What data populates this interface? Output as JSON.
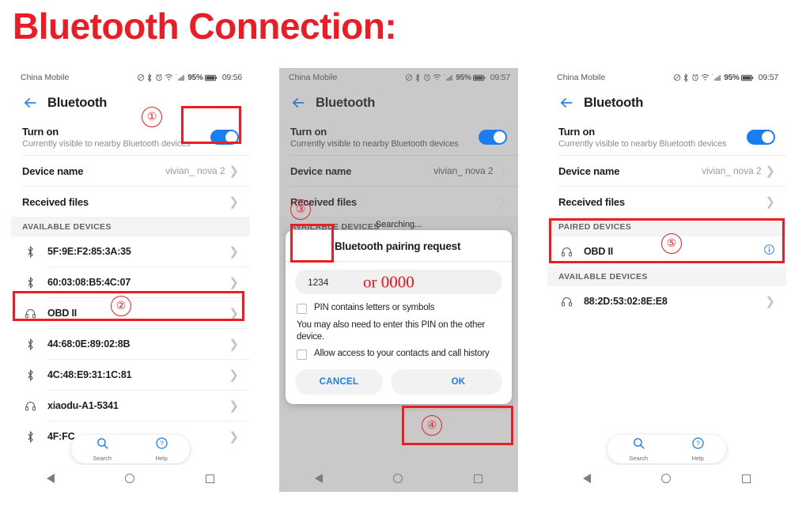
{
  "page": {
    "title": "Bluetooth Connection:",
    "accent_red": "#ee1d23",
    "toggle_blue": "#1a7ef0"
  },
  "statusbar": {
    "carrier": "China Mobile",
    "battery_percent": "95%",
    "time_1": "09:56",
    "time_2": "09:57",
    "time_3": "09:57",
    "icons": [
      "mute-icon",
      "bluetooth-icon",
      "alarm-icon",
      "wifi-icon",
      "signal-icon",
      "battery-icon"
    ]
  },
  "appbar": {
    "title": "Bluetooth",
    "back_label": "back-arrow"
  },
  "settings": {
    "turn_on": {
      "title": "Turn on",
      "sub": "Currently visible to nearby Bluetooth devices",
      "state": "on"
    },
    "device_name": {
      "title": "Device name",
      "value": "vivian_ nova 2"
    },
    "received_files": {
      "title": "Received files",
      "value": ""
    }
  },
  "sections": {
    "available": "AVAILABLE DEVICES",
    "paired": "PAIRED DEVICES"
  },
  "screen1": {
    "devices": [
      {
        "name": "5F:9E:F2:85:3A:35",
        "icon": "bluetooth-icon"
      },
      {
        "name": "60:03:08:B5:4C:07",
        "icon": "bluetooth-icon"
      },
      {
        "name": "OBD II",
        "icon": "headphone-icon"
      },
      {
        "name": "44:68:0E:89:02:8B",
        "icon": "bluetooth-icon"
      },
      {
        "name": "4C:48:E9:31:1C:81",
        "icon": "bluetooth-icon"
      },
      {
        "name": "xiaodu-A1-5341",
        "icon": "headphone-icon"
      },
      {
        "name": "4F:FC",
        "icon": "bluetooth-icon"
      }
    ]
  },
  "screen2": {
    "searching": "Searching...",
    "dialog": {
      "title": "Bluetooth pairing request",
      "pin_value": "1234",
      "pin_alt": "or  0000",
      "checkbox_pin": "PIN contains letters or symbols",
      "note": "You may also need to enter this PIN on the other device.",
      "checkbox_contacts": "Allow access to your contacts and call history",
      "cancel": "CANCEL",
      "ok": "OK"
    }
  },
  "screen3": {
    "paired_devices": [
      {
        "name": "OBD II",
        "icon": "headphone-icon",
        "action": "info-icon"
      }
    ],
    "available_devices": [
      {
        "name": "88:2D:53:02:8E:E8",
        "icon": "headphone-icon"
      }
    ]
  },
  "pill": {
    "search": "Search",
    "help": "Help"
  },
  "navbar": {
    "back": "nav-back-icon",
    "home": "nav-home-icon",
    "recents": "nav-recents-icon"
  },
  "annotations": {
    "n1": "①",
    "n2": "②",
    "n3": "③",
    "n4": "④",
    "n5": "⑤"
  }
}
